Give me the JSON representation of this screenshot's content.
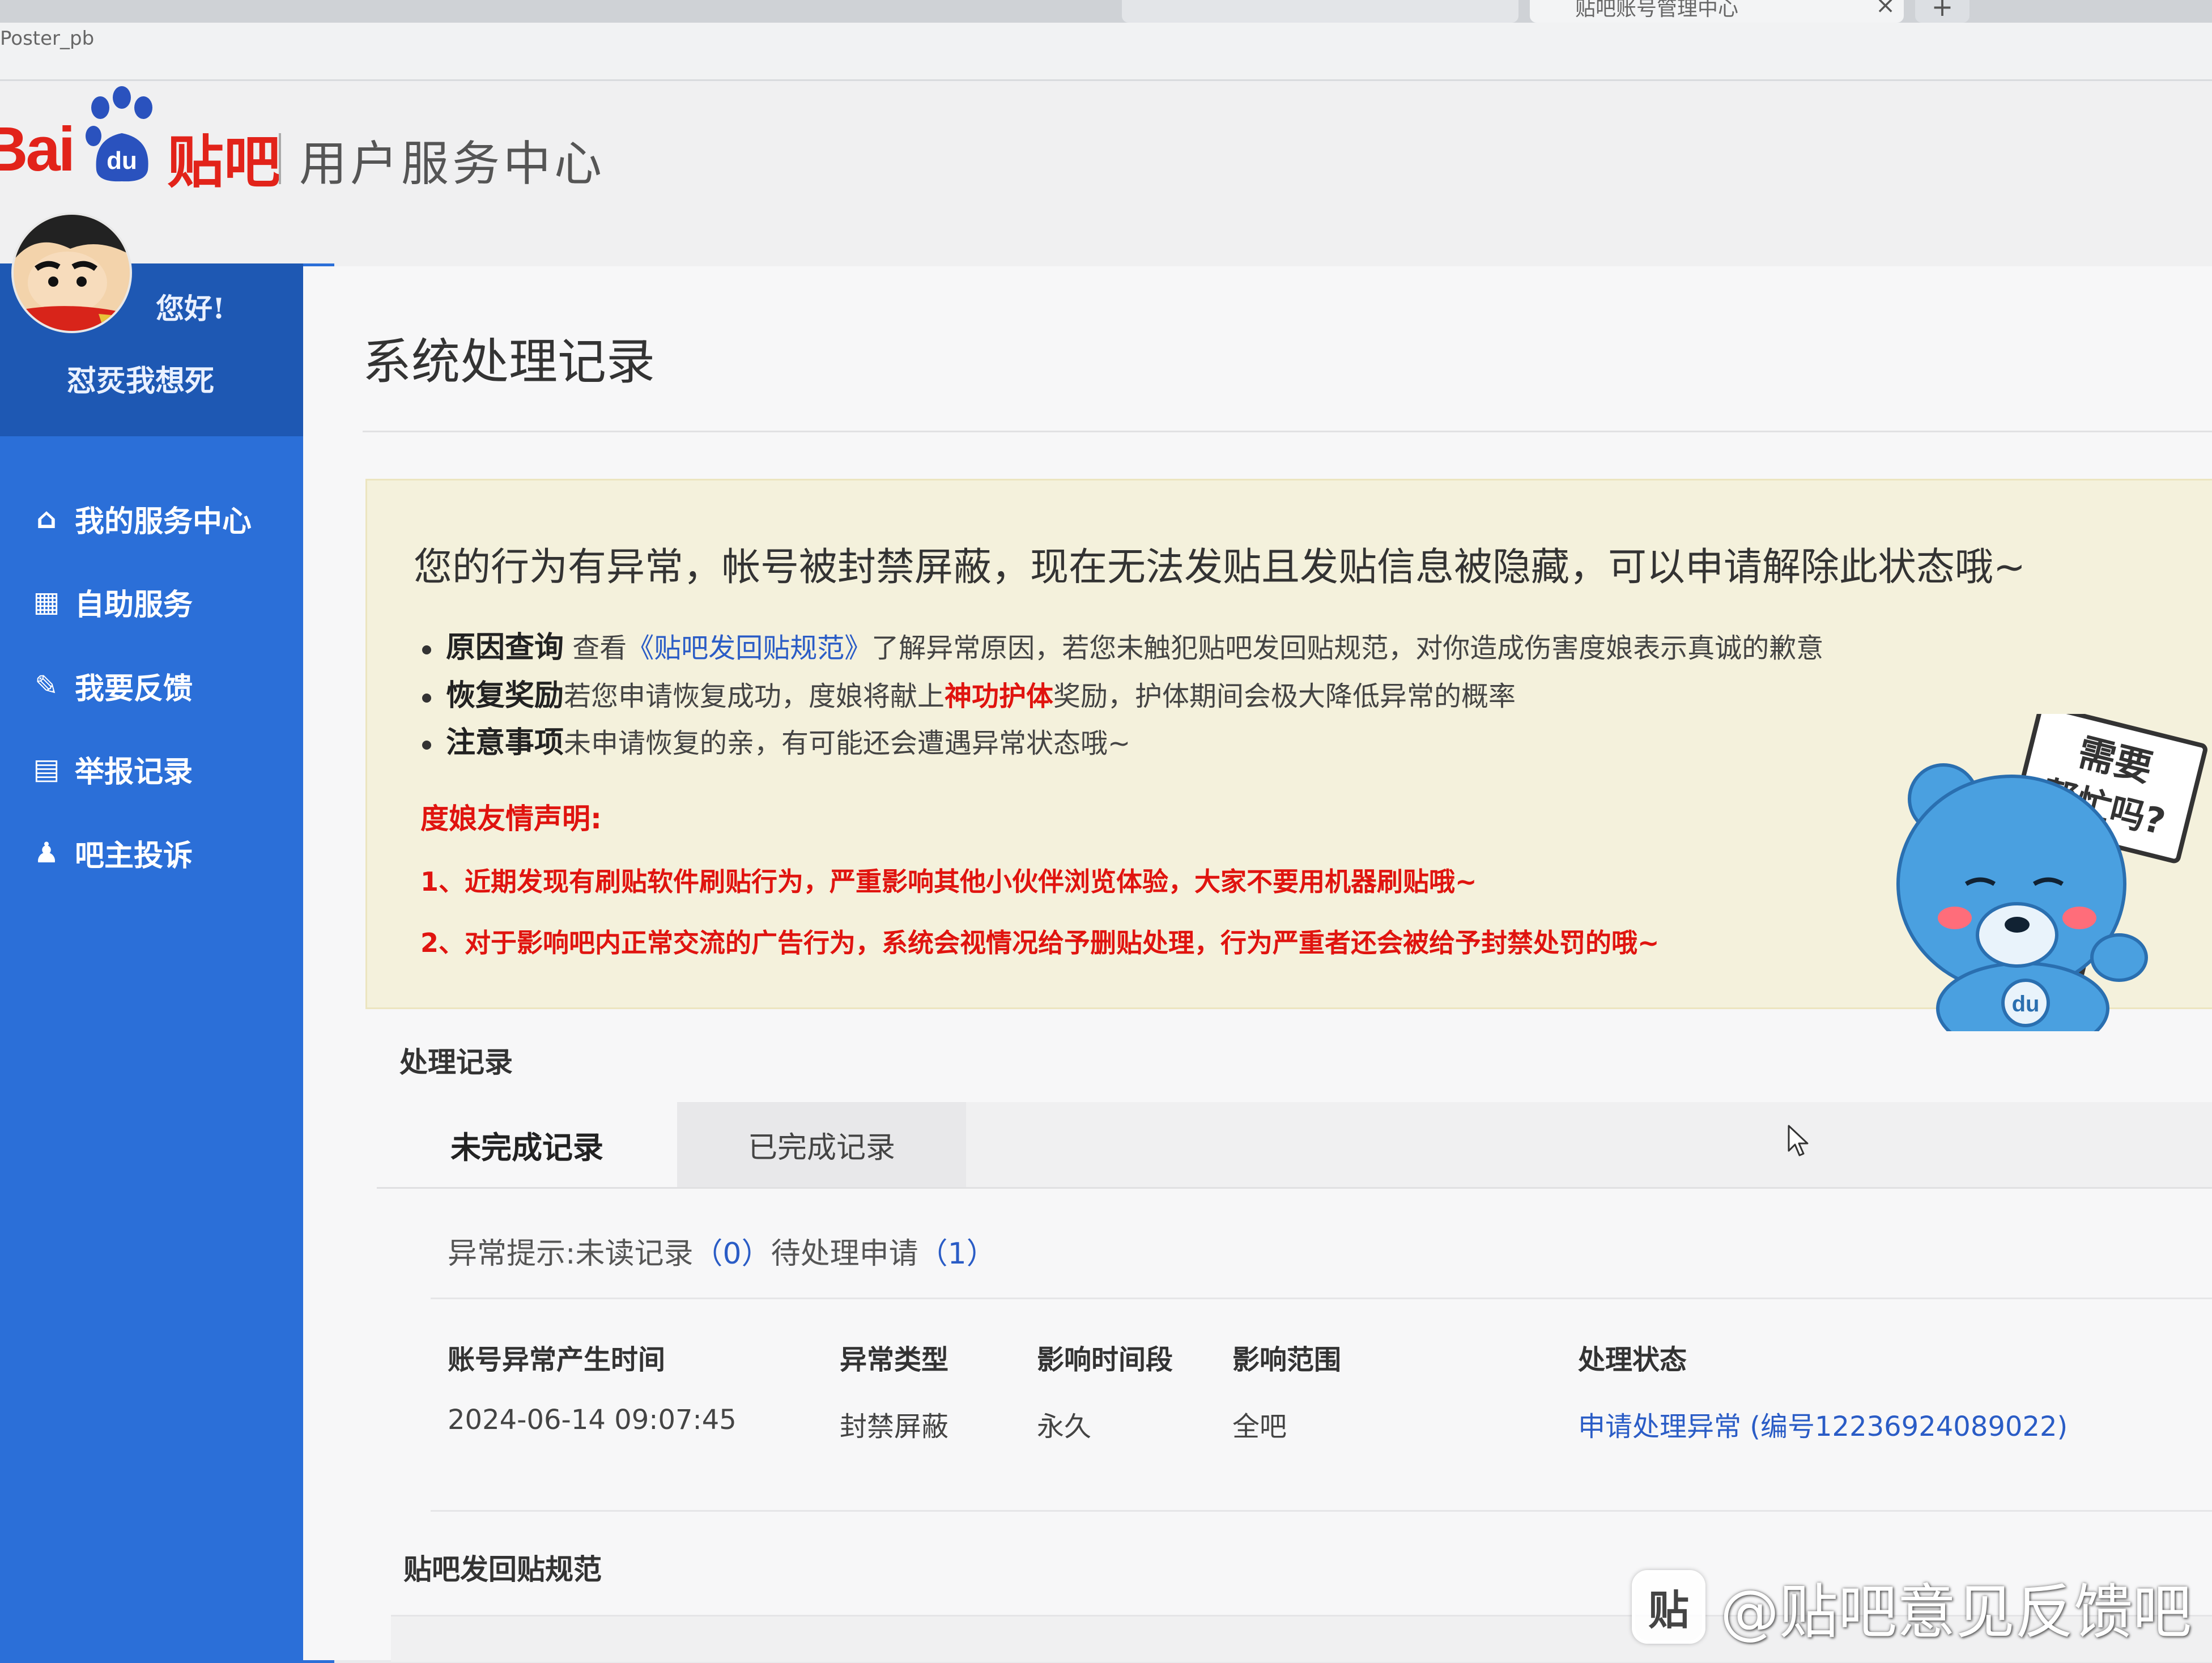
{
  "browser": {
    "tab_title": "贴吧账号管理中心",
    "tab_close": "×",
    "new_tab": "+",
    "bookmark": "Poster_pb"
  },
  "header": {
    "logo_bai": "Bai",
    "logo_du": "du",
    "logo_tieba": "贴吧",
    "title": "用户服务中心"
  },
  "sidebar": {
    "greeting": "您好!",
    "username": "怼烎我想死",
    "items": [
      {
        "label": "我的服务中心",
        "icon": "home-icon",
        "glyph": "⌂"
      },
      {
        "label": "自助服务",
        "icon": "grid-icon",
        "glyph": "▦"
      },
      {
        "label": "我要反馈",
        "icon": "edit-icon",
        "glyph": "✎"
      },
      {
        "label": "举报记录",
        "icon": "clipboard-icon",
        "glyph": "▤"
      },
      {
        "label": "吧主投诉",
        "icon": "bell-icon",
        "glyph": "♟"
      }
    ]
  },
  "main": {
    "page_title": "系统处理记录",
    "notice": {
      "headline": "您的行为有异常，帐号被封禁屏蔽，现在无法发贴且发贴信息被隐藏，可以申请解除此状态哦~",
      "bullets": [
        {
          "key": "原因查询",
          "pre": " 查看",
          "link": "《贴吧发回贴规范》",
          "post": "了解异常原因，若您未触犯贴吧发回贴规范，对你造成伤害度娘表示真诚的歉意"
        },
        {
          "key": "恢复奖励",
          "pre": "若您申请恢复成功，度娘将献上",
          "highlight": "神功护体",
          "post": "奖励，护体期间会极大降低异常的概率"
        },
        {
          "key": "注意事项",
          "pre": "未申请恢复的亲，有可能还会遭遇异常状态哦~"
        }
      ],
      "declare_title": "度娘友情声明:",
      "declarations": [
        "1、近期发现有刷贴软件刷贴行为，严重影响其他小伙伴浏览体验，大家不要用机器刷贴哦~",
        "2、对于影响吧内正常交流的广告行为，系统会视情况给予删贴处理，行为严重者还会被给予封禁处罚的哦~"
      ],
      "mascot_sign_line1": "需要",
      "mascot_sign_line2": "帮忙吗?",
      "mascot_badge": "du"
    },
    "records": {
      "section_title": "处理记录",
      "tabs": [
        "未完成记录",
        "已完成记录"
      ],
      "hint_label": "异常提示:",
      "unread_label": "未读记录",
      "unread_count": "（0）",
      "pending_label": "待处理申请",
      "pending_count": "（1）",
      "columns": [
        "账号异常产生时间",
        "异常类型",
        "影响时间段",
        "影响范围",
        "处理状态"
      ],
      "rows": [
        {
          "time": "2024-06-14 09:07:45",
          "type": "封禁屏蔽",
          "duration": "永久",
          "scope": "全吧",
          "status": "申请处理异常 (编号12236924089022)"
        }
      ]
    },
    "rules_title": "贴吧发回贴规范"
  },
  "watermark": {
    "icon_glyph": "贴",
    "text": "@贴吧意见反馈吧"
  },
  "colors": {
    "brand_red": "#e2231a",
    "sidebar_blue": "#2b6fd8",
    "link_blue": "#2a5cc6",
    "notice_bg": "#f4f1dc",
    "warning_red": "#e0140f"
  }
}
